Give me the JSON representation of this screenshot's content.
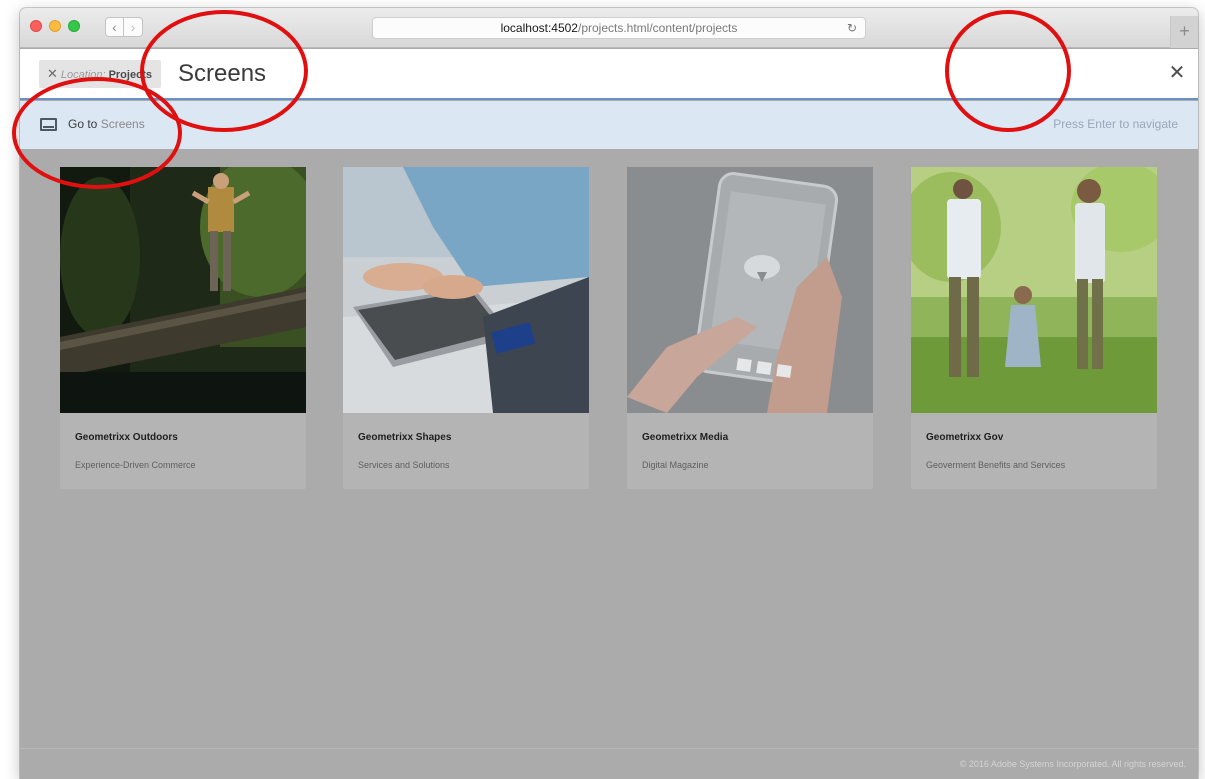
{
  "browser": {
    "url_host": "localhost:4502",
    "url_path": "/projects.html/content/projects",
    "back_glyph": "‹",
    "forward_glyph": "›",
    "reload_glyph": "↻",
    "newtab_glyph": "+"
  },
  "search": {
    "location_label": "Location:",
    "location_value": "Projects",
    "location_remove_glyph": "✕",
    "query": "Screens",
    "close_glyph": "✕"
  },
  "suggestion": {
    "icon": "screen-icon",
    "prefix": "Go to",
    "target": "Screens",
    "hint": "Press Enter to navigate"
  },
  "cards": [
    {
      "title": "Geometrixx Outdoors",
      "description": "Experience-Driven Commerce",
      "thumbnail": "forest-hiker-image"
    },
    {
      "title": "Geometrixx Shapes",
      "description": "Services and Solutions",
      "thumbnail": "laptop-user-image"
    },
    {
      "title": "Geometrixx Media",
      "description": "Digital Magazine",
      "thumbnail": "phone-hand-image"
    },
    {
      "title": "Geometrixx Gov",
      "description": "Geoverment Benefits and Services",
      "thumbnail": "family-walk-image"
    }
  ],
  "footer": {
    "copyright": "© 2016 Adobe Systems Incorporated. All rights reserved."
  },
  "colors": {
    "annotation": "#e01010",
    "focus_border": "#6e8fc5",
    "suggestion_bg": "#dce7f4",
    "overlay": "#ababab"
  }
}
